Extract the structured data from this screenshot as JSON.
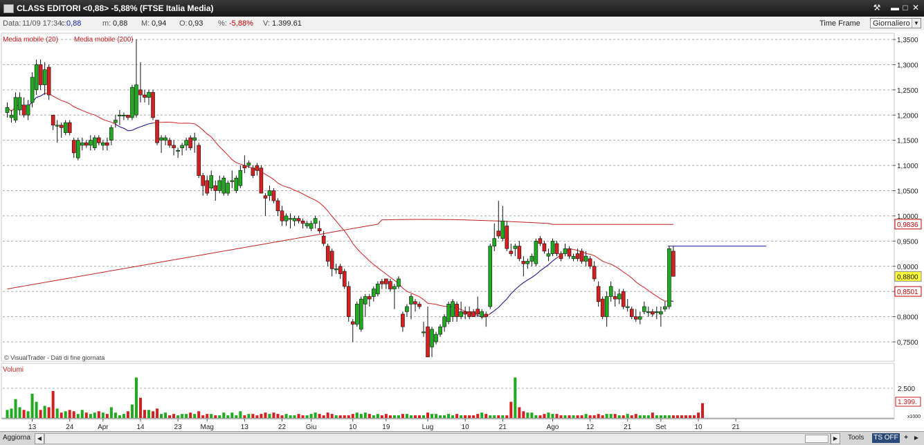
{
  "window": {
    "title": "CLASS EDITORI <0,88> -5,88%  (FTSE Italia Media)"
  },
  "infobar": {
    "data_label": "Data:",
    "data_value": "11/09 17:34",
    "c_label": "c:",
    "c_value": "0,88",
    "m_label": "m:",
    "m_value": "0,88",
    "M_label": "M:",
    "M_value": "0,94",
    "O_label": "O:",
    "O_value": "0,93",
    "pct_label": "%:",
    "pct_value": "-5,88%",
    "V_label": "V:",
    "V_value": "1.399.61",
    "timeframe_label": "Time Frame",
    "timeframe_value": "Giornaliero"
  },
  "colors": {
    "up": "#1faa1f",
    "down": "#d42020",
    "ma20": "#1a22a8",
    "ma200": "#c21e1e",
    "grid": "#a8a8a8",
    "accent": "#c00000"
  },
  "bottombar": {
    "refresh": "Aggiorna",
    "tools": "Tools",
    "ts": "TS OFF",
    "plus": "+"
  },
  "chart_data": {
    "type": "candlestick",
    "title": "CLASS EDITORI",
    "legend": [
      "Media mobile (20)",
      "Media mobile (200)"
    ],
    "credit": "© VisualTrader - Dati di fine giornata",
    "volume_label": "Volumi",
    "volume_unit": "x1000",
    "y_ticks": [
      "1,3500",
      "1,3000",
      "1,2500",
      "1,2000",
      "1,1500",
      "1,1000",
      "1,0500",
      "1,0000",
      "0,9500",
      "0,9000",
      "0,8500",
      "0,8000",
      "0,7500"
    ],
    "y_range": [
      0.72,
      1.36
    ],
    "price_badges": [
      {
        "text": "0,9836",
        "value": 0.9836,
        "style": "red-outline"
      },
      {
        "text": "0,8800",
        "value": 0.88,
        "style": "yellow"
      },
      {
        "text": "0,8501",
        "value": 0.8501,
        "style": "red-outline"
      }
    ],
    "volume_tick": "2.500",
    "volume_badge": "1.399.",
    "x_ticks": [
      {
        "i": 6,
        "label": "13"
      },
      {
        "i": 15,
        "label": "24"
      },
      {
        "i": 23,
        "label": "Apr"
      },
      {
        "i": 32,
        "label": "14"
      },
      {
        "i": 41,
        "label": "23"
      },
      {
        "i": 48,
        "label": "Mag"
      },
      {
        "i": 57,
        "label": "13"
      },
      {
        "i": 66,
        "label": "22"
      },
      {
        "i": 73,
        "label": "Giu"
      },
      {
        "i": 83,
        "label": "10"
      },
      {
        "i": 91,
        "label": "19"
      },
      {
        "i": 101,
        "label": "Lug"
      },
      {
        "i": 110,
        "label": "10"
      },
      {
        "i": 119,
        "label": "21"
      },
      {
        "i": 131,
        "label": "Ago"
      },
      {
        "i": 140,
        "label": "12"
      },
      {
        "i": 149,
        "label": "21"
      },
      {
        "i": 157,
        "label": "Set"
      },
      {
        "i": 166,
        "label": "10"
      },
      {
        "i": 175,
        "label": "21"
      }
    ],
    "resistance_line": {
      "i_start": 160,
      "i_end": 179,
      "value": 0.94
    },
    "candles": [
      {
        "o": 1.205,
        "h": 1.225,
        "l": 1.195,
        "c": 1.215
      },
      {
        "o": 1.195,
        "h": 1.21,
        "l": 1.185,
        "c": 1.2
      },
      {
        "o": 1.19,
        "h": 1.245,
        "l": 1.185,
        "c": 1.235
      },
      {
        "o": 1.21,
        "h": 1.245,
        "l": 1.2,
        "c": 1.235
      },
      {
        "o": 1.22,
        "h": 1.235,
        "l": 1.195,
        "c": 1.2
      },
      {
        "o": 1.2,
        "h": 1.23,
        "l": 1.19,
        "c": 1.22
      },
      {
        "o": 1.225,
        "h": 1.285,
        "l": 1.215,
        "c": 1.275
      },
      {
        "o": 1.25,
        "h": 1.31,
        "l": 1.24,
        "c": 1.3
      },
      {
        "o": 1.3,
        "h": 1.31,
        "l": 1.25,
        "c": 1.26
      },
      {
        "o": 1.26,
        "h": 1.305,
        "l": 1.24,
        "c": 1.29
      },
      {
        "o": 1.295,
        "h": 1.3,
        "l": 1.23,
        "c": 1.24
      },
      {
        "o": 1.2,
        "h": 1.2,
        "l": 1.17,
        "c": 1.18
      },
      {
        "o": 1.18,
        "h": 1.19,
        "l": 1.145,
        "c": 1.18
      },
      {
        "o": 1.18,
        "h": 1.185,
        "l": 1.155,
        "c": 1.175
      },
      {
        "o": 1.165,
        "h": 1.19,
        "l": 1.16,
        "c": 1.185
      },
      {
        "o": 1.185,
        "h": 1.19,
        "l": 1.16,
        "c": 1.165
      },
      {
        "o": 1.15,
        "h": 1.155,
        "l": 1.115,
        "c": 1.125
      },
      {
        "o": 1.115,
        "h": 1.155,
        "l": 1.11,
        "c": 1.15
      },
      {
        "o": 1.14,
        "h": 1.155,
        "l": 1.13,
        "c": 1.145
      },
      {
        "o": 1.145,
        "h": 1.15,
        "l": 1.135,
        "c": 1.14
      },
      {
        "o": 1.14,
        "h": 1.16,
        "l": 1.13,
        "c": 1.15
      },
      {
        "o": 1.135,
        "h": 1.16,
        "l": 1.13,
        "c": 1.155
      },
      {
        "o": 1.155,
        "h": 1.16,
        "l": 1.14,
        "c": 1.145
      },
      {
        "o": 1.14,
        "h": 1.15,
        "l": 1.13,
        "c": 1.145
      },
      {
        "o": 1.145,
        "h": 1.155,
        "l": 1.13,
        "c": 1.14
      },
      {
        "o": 1.15,
        "h": 1.18,
        "l": 1.14,
        "c": 1.175
      },
      {
        "o": 1.185,
        "h": 1.2,
        "l": 1.175,
        "c": 1.19
      },
      {
        "o": 1.2,
        "h": 1.21,
        "l": 1.18,
        "c": 1.2
      },
      {
        "o": 1.2,
        "h": 1.205,
        "l": 1.19,
        "c": 1.2
      },
      {
        "o": 1.2,
        "h": 1.2,
        "l": 1.19,
        "c": 1.195
      },
      {
        "o": 1.195,
        "h": 1.26,
        "l": 1.19,
        "c": 1.255
      },
      {
        "o": 1.2,
        "h": 1.35,
        "l": 1.195,
        "c": 1.26
      },
      {
        "o": 1.25,
        "h": 1.305,
        "l": 1.225,
        "c": 1.24
      },
      {
        "o": 1.24,
        "h": 1.25,
        "l": 1.225,
        "c": 1.235
      },
      {
        "o": 1.235,
        "h": 1.25,
        "l": 1.22,
        "c": 1.245
      },
      {
        "o": 1.245,
        "h": 1.25,
        "l": 1.19,
        "c": 1.195
      },
      {
        "o": 1.19,
        "h": 1.19,
        "l": 1.14,
        "c": 1.145
      },
      {
        "o": 1.15,
        "h": 1.16,
        "l": 1.125,
        "c": 1.155
      },
      {
        "o": 1.15,
        "h": 1.16,
        "l": 1.14,
        "c": 1.155
      },
      {
        "o": 1.15,
        "h": 1.155,
        "l": 1.135,
        "c": 1.14
      },
      {
        "o": 1.14,
        "h": 1.15,
        "l": 1.12,
        "c": 1.135
      },
      {
        "o": 1.13,
        "h": 1.135,
        "l": 1.115,
        "c": 1.13
      },
      {
        "o": 1.135,
        "h": 1.145,
        "l": 1.12,
        "c": 1.14
      },
      {
        "o": 1.14,
        "h": 1.155,
        "l": 1.13,
        "c": 1.15
      },
      {
        "o": 1.155,
        "h": 1.16,
        "l": 1.13,
        "c": 1.135
      },
      {
        "o": 1.15,
        "h": 1.165,
        "l": 1.125,
        "c": 1.155
      },
      {
        "o": 1.14,
        "h": 1.145,
        "l": 1.075,
        "c": 1.08
      },
      {
        "o": 1.08,
        "h": 1.085,
        "l": 1.04,
        "c": 1.06
      },
      {
        "o": 1.07,
        "h": 1.08,
        "l": 1.04,
        "c": 1.045
      },
      {
        "o": 1.055,
        "h": 1.09,
        "l": 1.05,
        "c": 1.08
      },
      {
        "o": 1.06,
        "h": 1.07,
        "l": 1.03,
        "c": 1.05
      },
      {
        "o": 1.05,
        "h": 1.08,
        "l": 1.045,
        "c": 1.07
      },
      {
        "o": 1.045,
        "h": 1.08,
        "l": 1.04,
        "c": 1.075
      },
      {
        "o": 1.045,
        "h": 1.07,
        "l": 1.04,
        "c": 1.065
      },
      {
        "o": 1.07,
        "h": 1.09,
        "l": 1.055,
        "c": 1.07
      },
      {
        "o": 1.05,
        "h": 1.08,
        "l": 1.045,
        "c": 1.075
      },
      {
        "o": 1.06,
        "h": 1.1,
        "l": 1.055,
        "c": 1.09
      },
      {
        "o": 1.1,
        "h": 1.12,
        "l": 1.085,
        "c": 1.095
      },
      {
        "o": 1.1,
        "h": 1.11,
        "l": 1.095,
        "c": 1.105
      },
      {
        "o": 1.095,
        "h": 1.1,
        "l": 1.075,
        "c": 1.08
      },
      {
        "o": 1.1,
        "h": 1.105,
        "l": 1.08,
        "c": 1.09
      },
      {
        "o": 1.095,
        "h": 1.1,
        "l": 1.045,
        "c": 1.045
      },
      {
        "o": 1.04,
        "h": 1.045,
        "l": 1.0,
        "c": 1.035
      },
      {
        "o": 1.04,
        "h": 1.06,
        "l": 1.03,
        "c": 1.05
      },
      {
        "o": 1.05,
        "h": 1.055,
        "l": 1.025,
        "c": 1.03
      },
      {
        "o": 1.03,
        "h": 1.035,
        "l": 1.0,
        "c": 1.01
      },
      {
        "o": 1.01,
        "h": 1.02,
        "l": 0.98,
        "c": 0.99
      },
      {
        "o": 0.99,
        "h": 1.005,
        "l": 0.98,
        "c": 1.0
      },
      {
        "o": 0.995,
        "h": 1.005,
        "l": 0.975,
        "c": 0.995
      },
      {
        "o": 0.99,
        "h": 1.0,
        "l": 0.98,
        "c": 0.995
      },
      {
        "o": 0.995,
        "h": 1.0,
        "l": 0.985,
        "c": 0.99
      },
      {
        "o": 0.99,
        "h": 0.995,
        "l": 0.975,
        "c": 0.985
      },
      {
        "o": 0.98,
        "h": 0.99,
        "l": 0.975,
        "c": 0.985
      },
      {
        "o": 0.975,
        "h": 0.99,
        "l": 0.97,
        "c": 0.985
      },
      {
        "o": 0.985,
        "h": 1.0,
        "l": 0.975,
        "c": 0.995
      },
      {
        "o": 0.975,
        "h": 0.99,
        "l": 0.965,
        "c": 0.97
      },
      {
        "o": 0.96,
        "h": 0.97,
        "l": 0.94,
        "c": 0.945
      },
      {
        "o": 0.94,
        "h": 0.945,
        "l": 0.9,
        "c": 0.91
      },
      {
        "o": 0.93,
        "h": 0.935,
        "l": 0.88,
        "c": 0.895
      },
      {
        "o": 0.895,
        "h": 0.905,
        "l": 0.885,
        "c": 0.895
      },
      {
        "o": 0.9,
        "h": 0.905,
        "l": 0.875,
        "c": 0.885
      },
      {
        "o": 0.89,
        "h": 0.895,
        "l": 0.855,
        "c": 0.86
      },
      {
        "o": 0.86,
        "h": 0.87,
        "l": 0.79,
        "c": 0.8
      },
      {
        "o": 0.79,
        "h": 0.795,
        "l": 0.75,
        "c": 0.785
      },
      {
        "o": 0.785,
        "h": 0.83,
        "l": 0.78,
        "c": 0.825
      },
      {
        "o": 0.775,
        "h": 0.84,
        "l": 0.77,
        "c": 0.835
      },
      {
        "o": 0.825,
        "h": 0.845,
        "l": 0.8,
        "c": 0.84
      },
      {
        "o": 0.84,
        "h": 0.845,
        "l": 0.82,
        "c": 0.835
      },
      {
        "o": 0.84,
        "h": 0.86,
        "l": 0.83,
        "c": 0.855
      },
      {
        "o": 0.845,
        "h": 0.87,
        "l": 0.84,
        "c": 0.865
      },
      {
        "o": 0.87,
        "h": 0.875,
        "l": 0.855,
        "c": 0.865
      },
      {
        "o": 0.875,
        "h": 0.875,
        "l": 0.855,
        "c": 0.865
      },
      {
        "o": 0.87,
        "h": 0.875,
        "l": 0.85,
        "c": 0.855
      },
      {
        "o": 0.855,
        "h": 0.865,
        "l": 0.815,
        "c": 0.86
      },
      {
        "o": 0.86,
        "h": 0.88,
        "l": 0.855,
        "c": 0.875
      },
      {
        "o": 0.805,
        "h": 0.81,
        "l": 0.77,
        "c": 0.78
      },
      {
        "o": 0.81,
        "h": 0.825,
        "l": 0.8,
        "c": 0.82
      },
      {
        "o": 0.825,
        "h": 0.845,
        "l": 0.795,
        "c": 0.84
      },
      {
        "o": 0.83,
        "h": 0.835,
        "l": 0.81,
        "c": 0.825
      },
      {
        "o": 0.825,
        "h": 0.83,
        "l": 0.815,
        "c": 0.82
      },
      {
        "o": 0.77,
        "h": 0.79,
        "l": 0.76,
        "c": 0.77
      },
      {
        "o": 0.78,
        "h": 0.82,
        "l": 0.72,
        "c": 0.72
      },
      {
        "o": 0.74,
        "h": 0.78,
        "l": 0.72,
        "c": 0.775
      },
      {
        "o": 0.75,
        "h": 0.77,
        "l": 0.745,
        "c": 0.765
      },
      {
        "o": 0.765,
        "h": 0.785,
        "l": 0.76,
        "c": 0.78
      },
      {
        "o": 0.78,
        "h": 0.805,
        "l": 0.77,
        "c": 0.8
      },
      {
        "o": 0.79,
        "h": 0.83,
        "l": 0.785,
        "c": 0.825
      },
      {
        "o": 0.8,
        "h": 0.835,
        "l": 0.79,
        "c": 0.83
      },
      {
        "o": 0.825,
        "h": 0.83,
        "l": 0.79,
        "c": 0.8
      },
      {
        "o": 0.8,
        "h": 0.83,
        "l": 0.795,
        "c": 0.81
      },
      {
        "o": 0.81,
        "h": 0.82,
        "l": 0.795,
        "c": 0.805
      },
      {
        "o": 0.81,
        "h": 0.82,
        "l": 0.795,
        "c": 0.8
      },
      {
        "o": 0.81,
        "h": 0.815,
        "l": 0.8,
        "c": 0.8
      },
      {
        "o": 0.815,
        "h": 0.84,
        "l": 0.8,
        "c": 0.805
      },
      {
        "o": 0.8,
        "h": 0.815,
        "l": 0.795,
        "c": 0.81
      },
      {
        "o": 0.805,
        "h": 0.81,
        "l": 0.78,
        "c": 0.8
      },
      {
        "o": 0.82,
        "h": 0.945,
        "l": 0.815,
        "c": 0.94
      },
      {
        "o": 0.94,
        "h": 0.985,
        "l": 0.93,
        "c": 0.955
      },
      {
        "o": 0.97,
        "h": 1.03,
        "l": 0.955,
        "c": 0.96
      },
      {
        "o": 0.955,
        "h": 1.02,
        "l": 0.95,
        "c": 0.99
      },
      {
        "o": 0.98,
        "h": 0.99,
        "l": 0.93,
        "c": 0.935
      },
      {
        "o": 0.93,
        "h": 0.945,
        "l": 0.92,
        "c": 0.925
      },
      {
        "o": 0.935,
        "h": 0.945,
        "l": 0.92,
        "c": 0.94
      },
      {
        "o": 0.94,
        "h": 0.95,
        "l": 0.91,
        "c": 0.915
      },
      {
        "o": 0.91,
        "h": 0.92,
        "l": 0.88,
        "c": 0.905
      },
      {
        "o": 0.905,
        "h": 0.915,
        "l": 0.895,
        "c": 0.91
      },
      {
        "o": 0.91,
        "h": 0.925,
        "l": 0.9,
        "c": 0.92
      },
      {
        "o": 0.905,
        "h": 0.955,
        "l": 0.9,
        "c": 0.95
      },
      {
        "o": 0.955,
        "h": 0.96,
        "l": 0.94,
        "c": 0.945
      },
      {
        "o": 0.945,
        "h": 0.95,
        "l": 0.925,
        "c": 0.93
      },
      {
        "o": 0.92,
        "h": 0.935,
        "l": 0.91,
        "c": 0.925
      },
      {
        "o": 0.925,
        "h": 0.955,
        "l": 0.92,
        "c": 0.95
      },
      {
        "o": 0.945,
        "h": 0.95,
        "l": 0.92,
        "c": 0.925
      },
      {
        "o": 0.925,
        "h": 0.93,
        "l": 0.91,
        "c": 0.915
      },
      {
        "o": 0.925,
        "h": 0.945,
        "l": 0.92,
        "c": 0.935
      },
      {
        "o": 0.935,
        "h": 0.94,
        "l": 0.915,
        "c": 0.92
      },
      {
        "o": 0.915,
        "h": 0.925,
        "l": 0.91,
        "c": 0.92
      },
      {
        "o": 0.925,
        "h": 0.935,
        "l": 0.91,
        "c": 0.915
      },
      {
        "o": 0.93,
        "h": 0.935,
        "l": 0.905,
        "c": 0.91
      },
      {
        "o": 0.91,
        "h": 0.93,
        "l": 0.9,
        "c": 0.92
      },
      {
        "o": 0.915,
        "h": 0.92,
        "l": 0.895,
        "c": 0.9
      },
      {
        "o": 0.9,
        "h": 0.91,
        "l": 0.87,
        "c": 0.875
      },
      {
        "o": 0.86,
        "h": 0.87,
        "l": 0.82,
        "c": 0.83
      },
      {
        "o": 0.835,
        "h": 0.84,
        "l": 0.795,
        "c": 0.8
      },
      {
        "o": 0.8,
        "h": 0.85,
        "l": 0.78,
        "c": 0.84
      },
      {
        "o": 0.84,
        "h": 0.87,
        "l": 0.83,
        "c": 0.86
      },
      {
        "o": 0.84,
        "h": 0.85,
        "l": 0.82,
        "c": 0.835
      },
      {
        "o": 0.835,
        "h": 0.855,
        "l": 0.825,
        "c": 0.845
      },
      {
        "o": 0.85,
        "h": 0.855,
        "l": 0.815,
        "c": 0.82
      },
      {
        "o": 0.82,
        "h": 0.835,
        "l": 0.81,
        "c": 0.82
      },
      {
        "o": 0.815,
        "h": 0.82,
        "l": 0.795,
        "c": 0.8
      },
      {
        "o": 0.8,
        "h": 0.815,
        "l": 0.79,
        "c": 0.795
      },
      {
        "o": 0.795,
        "h": 0.81,
        "l": 0.785,
        "c": 0.8
      },
      {
        "o": 0.81,
        "h": 0.83,
        "l": 0.805,
        "c": 0.82
      },
      {
        "o": 0.81,
        "h": 0.82,
        "l": 0.8,
        "c": 0.81
      },
      {
        "o": 0.81,
        "h": 0.815,
        "l": 0.8,
        "c": 0.805
      },
      {
        "o": 0.81,
        "h": 0.82,
        "l": 0.795,
        "c": 0.81
      },
      {
        "o": 0.805,
        "h": 0.82,
        "l": 0.78,
        "c": 0.81
      },
      {
        "o": 0.815,
        "h": 0.83,
        "l": 0.81,
        "c": 0.82
      },
      {
        "o": 0.82,
        "h": 0.94,
        "l": 0.815,
        "c": 0.935
      },
      {
        "o": 0.93,
        "h": 0.94,
        "l": 0.88,
        "c": 0.88
      }
    ],
    "volumes": [
      6,
      7,
      14,
      8,
      6,
      5,
      18,
      12,
      6,
      9,
      8,
      20,
      7,
      4,
      5,
      6,
      5,
      3,
      6,
      4,
      3,
      4,
      5,
      4,
      3,
      8,
      4,
      2,
      3,
      5,
      10,
      30,
      15,
      6,
      6,
      5,
      7,
      3,
      4,
      2,
      3,
      2,
      3,
      3,
      4,
      3,
      5,
      2,
      3,
      3,
      2,
      2,
      4,
      2,
      4,
      2,
      5,
      2,
      3,
      3,
      2,
      3,
      4,
      3,
      4,
      3,
      2,
      3,
      2,
      2,
      3,
      2,
      2,
      3,
      4,
      3,
      2,
      4,
      3,
      2,
      2,
      2,
      2,
      3,
      4,
      3,
      4,
      3,
      2,
      3,
      2,
      3,
      2,
      2,
      2,
      3,
      3,
      2,
      2,
      2,
      2,
      4,
      3,
      3,
      2,
      2,
      3,
      2,
      3,
      2,
      2,
      2,
      2,
      3,
      4,
      3,
      2,
      2,
      2,
      2,
      2,
      12,
      30,
      8,
      5,
      4,
      4,
      2,
      2,
      3,
      4,
      3,
      3,
      2,
      2,
      2,
      2,
      2,
      2,
      3,
      2,
      2,
      3,
      2,
      3,
      3,
      3,
      2,
      2,
      3,
      2,
      3,
      2,
      2,
      2,
      4,
      2,
      2,
      2,
      2,
      2,
      2,
      2,
      2,
      2,
      2,
      4,
      11
    ]
  }
}
